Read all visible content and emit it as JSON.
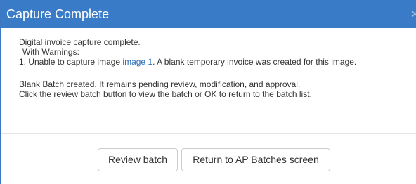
{
  "dialog": {
    "title": "Capture Complete",
    "close_label": "×"
  },
  "message": {
    "line1": "Digital invoice capture complete.",
    "line2": "With Warnings:",
    "warning_prefix": "1. Unable to capture image ",
    "warning_link": "image 1",
    "warning_suffix": ".  A blank temporary invoice was created for this image.",
    "line4": "Blank Batch created. It remains pending review, modification, and approval.",
    "line5": "Click the review batch button to view the batch or OK to return to the batch list."
  },
  "buttons": {
    "review": "Review batch",
    "return": "Return to AP Batches screen"
  },
  "colors": {
    "titlebar": "#3a7bc8",
    "link": "#2a6ebb"
  }
}
